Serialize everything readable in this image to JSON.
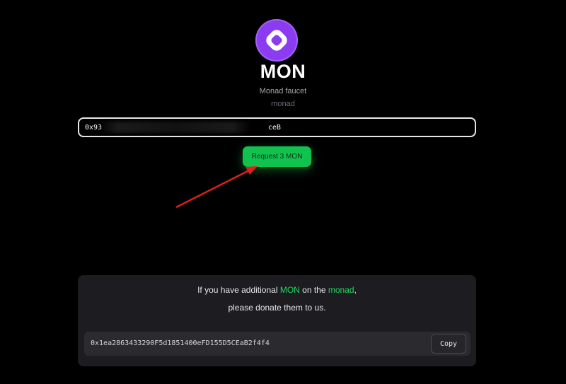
{
  "header": {
    "logo_icon": "monad-logo-icon",
    "title": "MON",
    "subtitle": "Monad faucet",
    "network": "monad"
  },
  "address_input": {
    "value": "0x93                                       ceB",
    "placeholder": ""
  },
  "request_button": {
    "label": "Request 3 MON"
  },
  "donate": {
    "line1_prefix": "If you have additional ",
    "line1_token": "MON",
    "line1_mid": " on the ",
    "line1_network": "monad",
    "line1_suffix": ",",
    "line2": "please donate them to us.",
    "address": "0x1ea2863433290F5d1851400eFD155D5CEaB2f4f4",
    "copy_label": "Copy"
  },
  "colors": {
    "background": "#000000",
    "brand_purple": "#8b3cf0",
    "accent_green": "#12c24f",
    "card": "#1d1d21",
    "annotation_arrow": "#e11d1d"
  }
}
